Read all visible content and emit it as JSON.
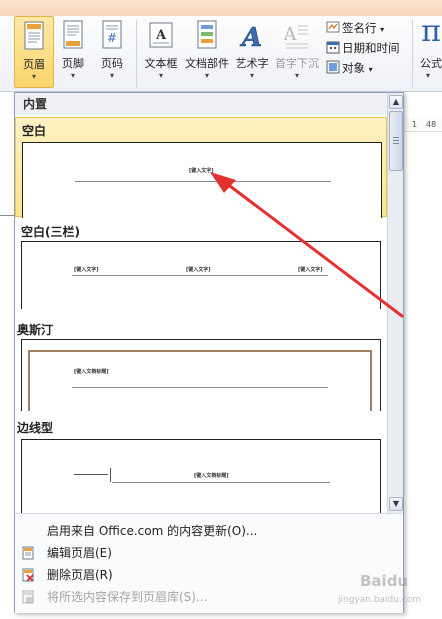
{
  "ribbon": {
    "header": "页眉",
    "footer": "页脚",
    "page_number": "页码",
    "text_box": "文本框",
    "quick_parts": "文档部件",
    "wordart": "艺术字",
    "drop_cap": "首字下沉",
    "signature_line": "签名行",
    "date_time": "日期和时间",
    "object": "对象",
    "equation": "公式",
    "dropdown_arrow": "▾"
  },
  "ruler": {
    "n1": "1",
    "n2": "48"
  },
  "gallery": {
    "section_builtin": "内置",
    "items": [
      {
        "title": "空白",
        "placeholders": [
          "[键入文字]"
        ]
      },
      {
        "title": "空白(三栏)",
        "placeholders": [
          "[键入文字]",
          "[键入文字]",
          "[键入文字]"
        ]
      },
      {
        "title": "奥斯汀",
        "placeholders": [
          "[键入文档标题]"
        ]
      },
      {
        "title": "边线型",
        "placeholders": [
          "[键入文档标题]"
        ]
      }
    ]
  },
  "menu": {
    "update": "启用来自 Office.com 的内容更新(O)...",
    "edit": "编辑页眉(E)",
    "delete": "删除页眉(R)",
    "save": "将所选内容保存到页眉库(S)..."
  },
  "watermark": {
    "brand": "Baidu",
    "url": "jingyan.baidu.com"
  },
  "colors": {
    "selected": "#fbe489",
    "arrow": "#e53030",
    "austin_frame": "#a08060"
  }
}
